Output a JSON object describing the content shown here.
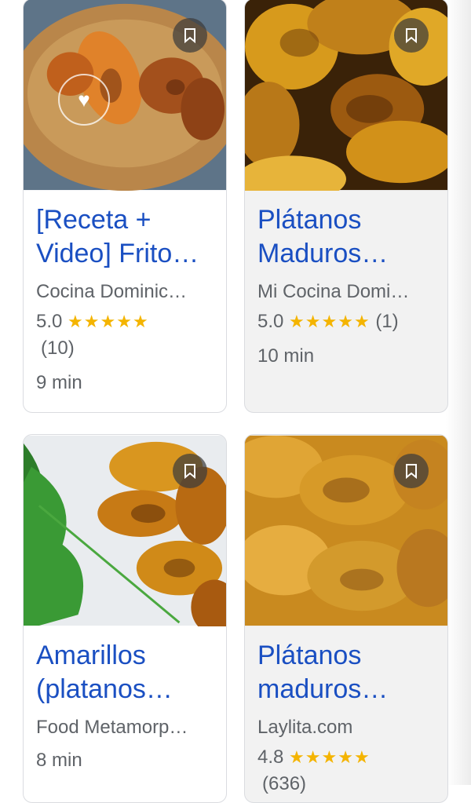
{
  "cards": [
    {
      "title_line1": "[Receta +",
      "title_line2": "Video] Frito…",
      "source": "Cocina Dominic…",
      "rating": "5.0",
      "stars": "★★★★★",
      "reviews": "(10)",
      "time": "9 min"
    },
    {
      "title_line1": "Plátanos",
      "title_line2": "Maduros…",
      "source": "Mi Cocina Domi…",
      "rating": "5.0",
      "stars": "★★★★★",
      "reviews": "(1)",
      "time": "10 min"
    },
    {
      "title_line1": "Amarillos",
      "title_line2": "(platanos…",
      "source": "Food Metamorp…",
      "time": "8 min"
    },
    {
      "title_line1": "Plátanos",
      "title_line2": "maduros…",
      "source": "Laylita.com",
      "rating": "4.8",
      "stars": "★★★★★",
      "reviews": "(636)"
    }
  ],
  "icons": {
    "bookmark": "bookmark-icon",
    "watermark": "heart-icon"
  },
  "colors": {
    "title": "#1a4fc2",
    "source": "#5f6368",
    "star": "#f4b400",
    "border": "#dadce0"
  }
}
